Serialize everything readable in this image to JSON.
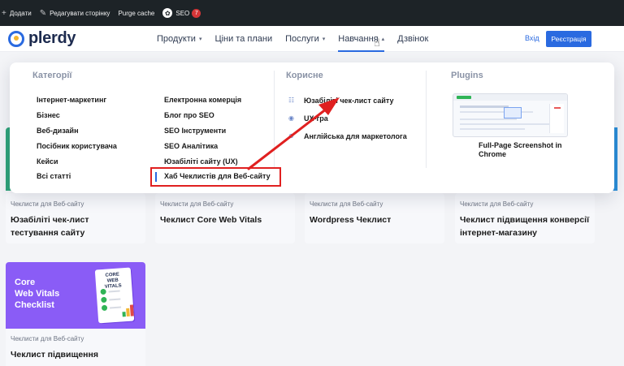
{
  "adminbar": {
    "items": [
      "Додати",
      "Редагувати сторінку",
      "Purge cache",
      "SEO"
    ],
    "seo_badge": "7"
  },
  "header": {
    "logo_text": "plerdy",
    "nav": [
      "Продукти",
      "Ціни та плани",
      "Послуги",
      "Навчання",
      "Дзвінок"
    ],
    "login": "Вхід",
    "signup": "Реєстрація"
  },
  "mega_menu": {
    "categories_title": "Категорії",
    "categories_col1": [
      "Інтернет-маркетинг",
      "Бізнес",
      "Веб-дизайн",
      "Посібник користувача",
      "Кейси",
      "Всі статті"
    ],
    "categories_col2": [
      "Електронна комерція",
      "Блог про SEO",
      "SEO Інструменти",
      "SEO Аналітика",
      "Юзабіліті сайту (UX)",
      "Хаб Чеклистів для Веб-сайту"
    ],
    "useful_title": "Корисне",
    "useful": [
      "Юзабіліті чек-лист сайту",
      "UX-гра",
      "Англійська для маркетолога"
    ],
    "plugins_title": "Plugins",
    "plugin_name": "Full-Page Screenshot in Chrome"
  },
  "cards": [
    {
      "category": "Чеклисти для Веб-сайту",
      "title": "Юзабіліті чек-лист тестування сайту"
    },
    {
      "category": "Чеклисти для Веб-сайту",
      "title": "Чеклист Core Web Vitals"
    },
    {
      "category": "Чеклисти для Веб-сайту",
      "title": "Wordpress Чеклист"
    },
    {
      "category": "Чеклисти для Веб-сайту",
      "title": "Чеклист підвищення конверсії інтернет-магазину"
    },
    {
      "category": "Чеклисти для Веб-сайту",
      "title": "Чеклист підвищення"
    }
  ],
  "promo": {
    "lines": [
      "Core",
      "Web Vitals",
      "Checklist"
    ],
    "doc_title": "CORE WEB VITALS"
  },
  "colors": {
    "accent": "#2a6ae0",
    "annotation": "#e02020",
    "promo_purple": "#8a5cf6"
  }
}
